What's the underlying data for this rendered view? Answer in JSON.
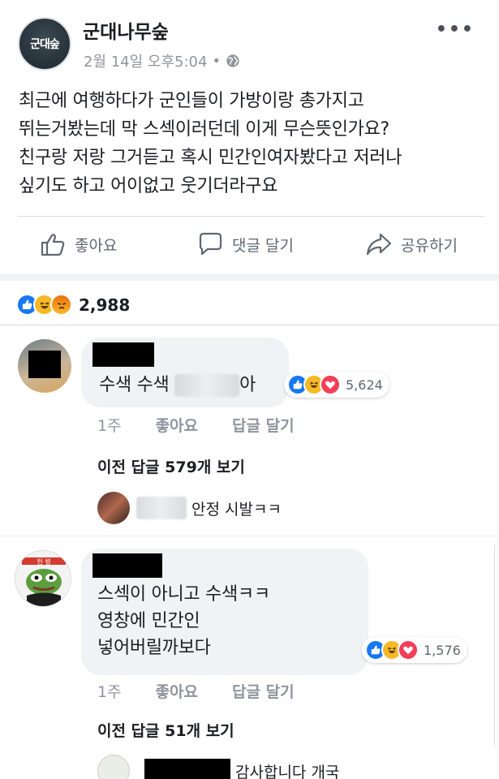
{
  "post": {
    "page_name": "군대나무숲",
    "avatar_text": "군대숲",
    "date": "2월 14일 오후5:04",
    "dot": "•",
    "more": "•••",
    "text_lines": [
      "최근에 여행하다가 군인들이 가방이랑 총가지고",
      "뛰는거봤는데 막 스섹이러던데 이게 무슨뜻인가요?",
      "친구랑 저랑 그거듣고 혹시 민간인여자봤다고 저러나",
      "싶기도 하고 어이없고 웃기더라구요"
    ]
  },
  "actions": {
    "like": "좋아요",
    "comment": "댓글 달기",
    "share": "공유하기"
  },
  "reactions": {
    "count": "2,988",
    "types": [
      "like",
      "haha",
      "angry"
    ]
  },
  "comments": [
    {
      "text_before": "수색 수색",
      "text_after": "아",
      "reaction_count": "5,624",
      "time": "1주",
      "like": "좋아요",
      "reply": "답글 달기",
      "prev_replies_prefix": "이전 답글 ",
      "prev_replies_count": "579",
      "prev_replies_suffix": "개 보기",
      "reply_text": "안정 시발ㅋㅋ"
    },
    {
      "text_lines": [
        "스섹이 아니고 수색ㅋㅋ",
        "영창에 민간인",
        "넣어버릴까보다"
      ],
      "avatar_badge": "헌 병",
      "reaction_count": "1,576",
      "time": "1주",
      "like": "좋아요",
      "reply": "답글 달기",
      "prev_replies_prefix": "이전 답글 ",
      "prev_replies_count": "51",
      "prev_replies_suffix": "개 보기",
      "reply_text": "감사합니다 개국"
    }
  ]
}
